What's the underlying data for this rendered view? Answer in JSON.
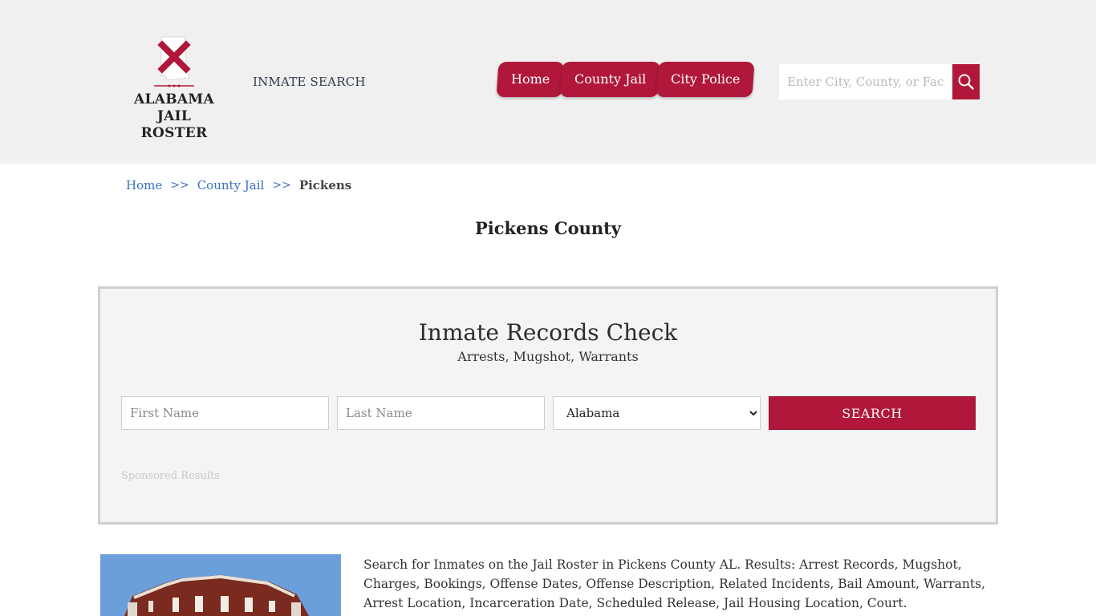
{
  "header": {
    "logo_line1": "ALABAMA",
    "logo_line2": "JAIL ROSTER",
    "inmate_search_label": "INMATE SEARCH",
    "nav": [
      {
        "label": "Home"
      },
      {
        "label": "County Jail"
      },
      {
        "label": "City Police"
      }
    ],
    "search_placeholder": "Enter City, County, or Facility",
    "search_icon": "search-icon"
  },
  "breadcrumb": {
    "items": [
      {
        "label": "Home"
      },
      {
        "label": "County Jail"
      }
    ],
    "separator": ">>",
    "current": "Pickens"
  },
  "page_title": "Pickens County",
  "records": {
    "title": "Inmate Records Check",
    "subtitle": "Arrests, Mugshot, Warrants",
    "first_name_placeholder": "First Name",
    "last_name_placeholder": "Last Name",
    "state_selected": "Alabama",
    "search_label": "SEARCH",
    "sponsored": "Sponsored Results"
  },
  "intro": "Search for Inmates on the Jail Roster in Pickens County AL. Results: Arrest Records, Mugshot, Charges, Bookings, Offense Dates, Offense Description, Related Incidents, Bail Amount, Warrants, Arrest Location, Incarceration Date, Scheduled Release, Jail Housing Location, Court.",
  "colors": {
    "accent": "#b0173a",
    "header_bg": "#f0f0f0",
    "link": "#3a6fc4"
  }
}
